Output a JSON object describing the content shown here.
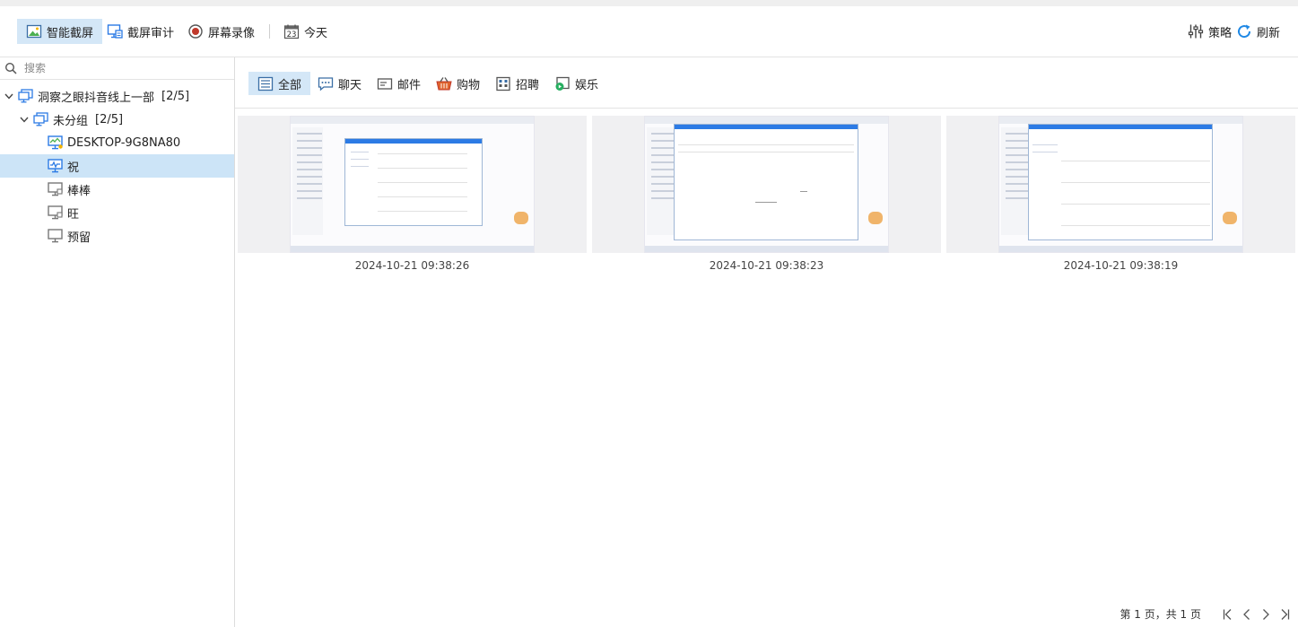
{
  "toolbar": {
    "smart_screenshot": "智能截屏",
    "screenshot_audit": "截屏审计",
    "screen_recording": "屏幕录像",
    "today": "今天",
    "today_day": "23",
    "strategy": "策略",
    "refresh": "刷新"
  },
  "sidebar": {
    "search_placeholder": "搜索",
    "tree": [
      {
        "label": "洞察之眼抖音线上一部",
        "count": "[2/5]"
      },
      {
        "label": "未分组",
        "count": "[2/5]"
      },
      {
        "label": "DESKTOP-9G8NA80"
      },
      {
        "label": "祝"
      },
      {
        "label": "棒棒"
      },
      {
        "label": "旺"
      },
      {
        "label": "预留"
      }
    ]
  },
  "categories": [
    "全部",
    "聊天",
    "邮件",
    "购物",
    "招聘",
    "娱乐"
  ],
  "screenshots": [
    {
      "timestamp": "2024-10-21 09:38:26"
    },
    {
      "timestamp": "2024-10-21 09:38:23"
    },
    {
      "timestamp": "2024-10-21 09:38:19"
    }
  ],
  "pagination": {
    "text": "第 1 页，共 1 页"
  },
  "colors": {
    "accent": "#2c7be5",
    "selected_bg": "#cce4f7",
    "active_tab_bg": "#d4e7f7",
    "record_red": "#c0392b",
    "refresh_blue": "#1e88e5"
  }
}
